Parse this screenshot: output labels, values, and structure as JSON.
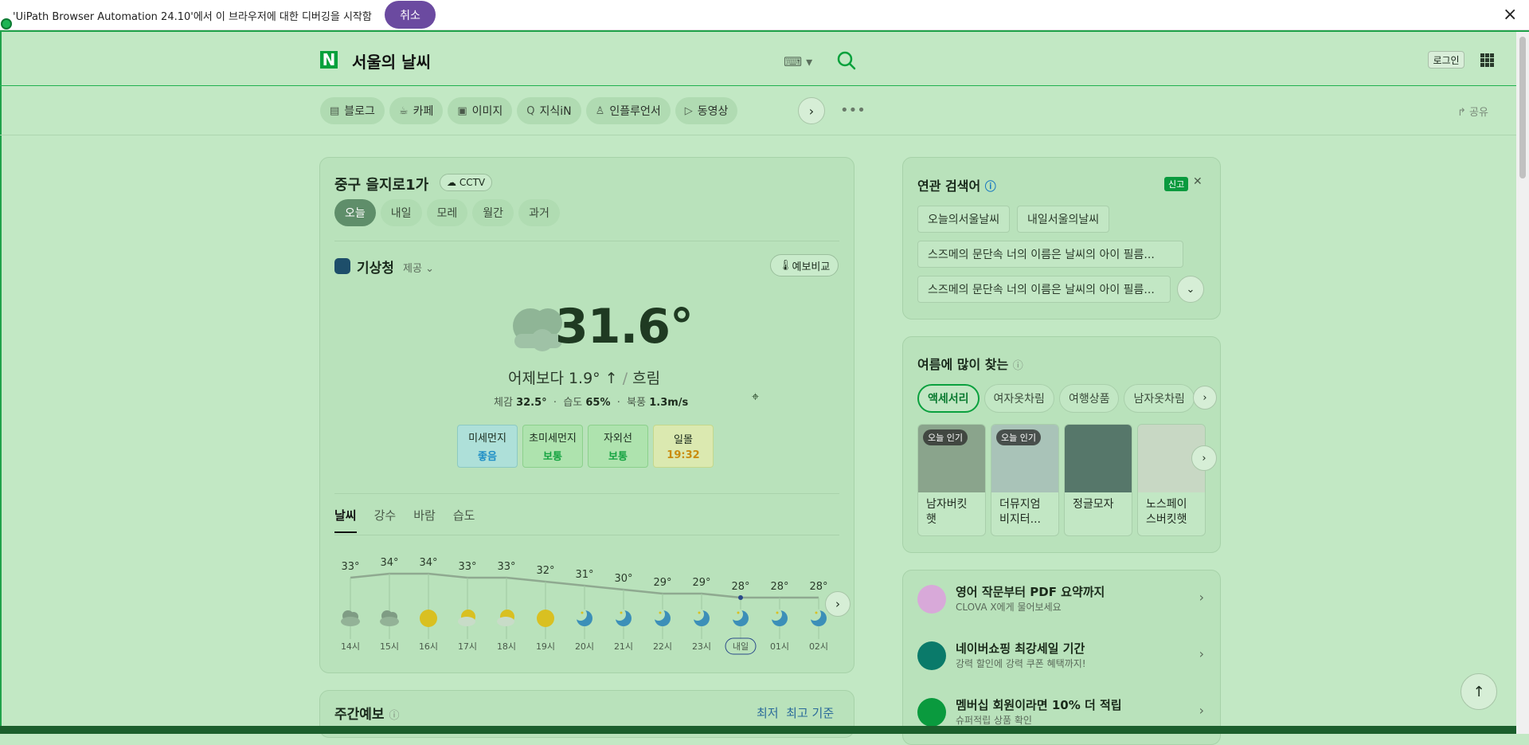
{
  "debug_banner": {
    "message": "'UiPath Browser Automation 24.10'에서 이 브라우저에 대한 디버깅을 시작함",
    "cancel_label": "취소",
    "close_icon": "×"
  },
  "header": {
    "logo": "N",
    "title": "서울의 날씨",
    "login_label": "로그인"
  },
  "tabs": [
    {
      "icon": "blog-icon",
      "glyph": "▤",
      "label": "블로그"
    },
    {
      "icon": "cafe-icon",
      "glyph": "☕",
      "label": "카페"
    },
    {
      "icon": "image-icon",
      "glyph": "▣",
      "label": "이미지"
    },
    {
      "icon": "kin-icon",
      "glyph": "Q",
      "label": "지식iN"
    },
    {
      "icon": "influencer-icon",
      "glyph": "♙",
      "label": "인플루언서"
    },
    {
      "icon": "video-icon",
      "glyph": "▷",
      "label": "동영상"
    }
  ],
  "share_label": "공유",
  "weather": {
    "location": "중구 을지로1가",
    "cctv_label": "CCTV",
    "day_tabs": [
      "오늘",
      "내일",
      "모레",
      "월간",
      "과거"
    ],
    "provider": "기상청",
    "provider_suffix": "제공",
    "compare_label": "예보비교",
    "temperature": "31.6°",
    "summary_prefix": "어제보다",
    "summary_diff": "1.9° ↑",
    "summary_sep": "/",
    "condition": "흐림",
    "feels_label": "체감",
    "feels_value": "32.5°",
    "humidity_label": "습도",
    "humidity_value": "65%",
    "wind_label": "북풍",
    "wind_value": "1.3m/s",
    "chips": [
      {
        "label": "미세먼지",
        "value": "좋음"
      },
      {
        "label": "초미세먼지",
        "value": "보통"
      },
      {
        "label": "자외선",
        "value": "보통"
      },
      {
        "label": "일몰",
        "value": "19:32"
      }
    ],
    "detail_tabs": [
      "날씨",
      "강수",
      "바람",
      "습도"
    ],
    "hourly": [
      {
        "temp": "33°",
        "icon": "partly-cloudy",
        "time": "14시"
      },
      {
        "temp": "34°",
        "icon": "partly-cloudy",
        "time": "15시"
      },
      {
        "temp": "34°",
        "icon": "sun",
        "time": "16시"
      },
      {
        "temp": "33°",
        "icon": "sun-cloud",
        "time": "17시"
      },
      {
        "temp": "33°",
        "icon": "sun-cloud",
        "time": "18시"
      },
      {
        "temp": "32°",
        "icon": "sun",
        "time": "19시"
      },
      {
        "temp": "31°",
        "icon": "moon",
        "time": "20시"
      },
      {
        "temp": "30°",
        "icon": "moon",
        "time": "21시"
      },
      {
        "temp": "29°",
        "icon": "moon",
        "time": "22시"
      },
      {
        "temp": "29°",
        "icon": "moon",
        "time": "23시"
      },
      {
        "temp": "28°",
        "icon": "moon",
        "time": "내일"
      },
      {
        "temp": "28°",
        "icon": "moon",
        "time": "01시"
      },
      {
        "temp": "28°",
        "icon": "moon",
        "time": "02시"
      }
    ],
    "weekly_title": "주간예보",
    "weekly_right_1": "최저",
    "weekly_right_2": "최고 기준"
  },
  "related": {
    "title": "연관 검색어",
    "report_label": "신고",
    "keywords": [
      "오늘의서울날씨",
      "내일서울의날씨",
      "스즈메의 문단속 너의 이름은 날씨의 아이 필름...",
      "스즈메의 문단속 너의 이름은 날씨의 아이 필름..."
    ]
  },
  "summer": {
    "title": "여름에 많이 찾는",
    "categories": [
      "액세서리",
      "여자옷차림",
      "여행상품",
      "남자옷차림"
    ],
    "products": [
      {
        "name": "남자버킷햇",
        "badge": "오늘 인기",
        "color": "#8aa48c"
      },
      {
        "name": "더뮤지엄비지터...",
        "badge": "오늘 인기",
        "color": "#a9c3b8"
      },
      {
        "name": "정글모자",
        "badge": "",
        "color": "#56776a"
      },
      {
        "name": "노스페이스버킷햇",
        "badge": "",
        "color": "#c8d8c4"
      }
    ]
  },
  "ads": [
    {
      "title": "영어 작문부터 PDF 요약까지",
      "sub": "CLOVA X에게 물어보세요",
      "color": "#d8a9d9"
    },
    {
      "title": "네이버쇼핑 최강세일 기간",
      "sub": "강력 할인에 강력 쿠폰 혜택까지!",
      "color": "#0a7a6a"
    },
    {
      "title": "멤버십 회원이라면 10% 더 적립",
      "sub": "슈퍼적립 상품 확인",
      "color": "#0a9a3e"
    }
  ],
  "colors": {
    "accent": "#06a13c",
    "overlay": "#c2e8c4"
  }
}
